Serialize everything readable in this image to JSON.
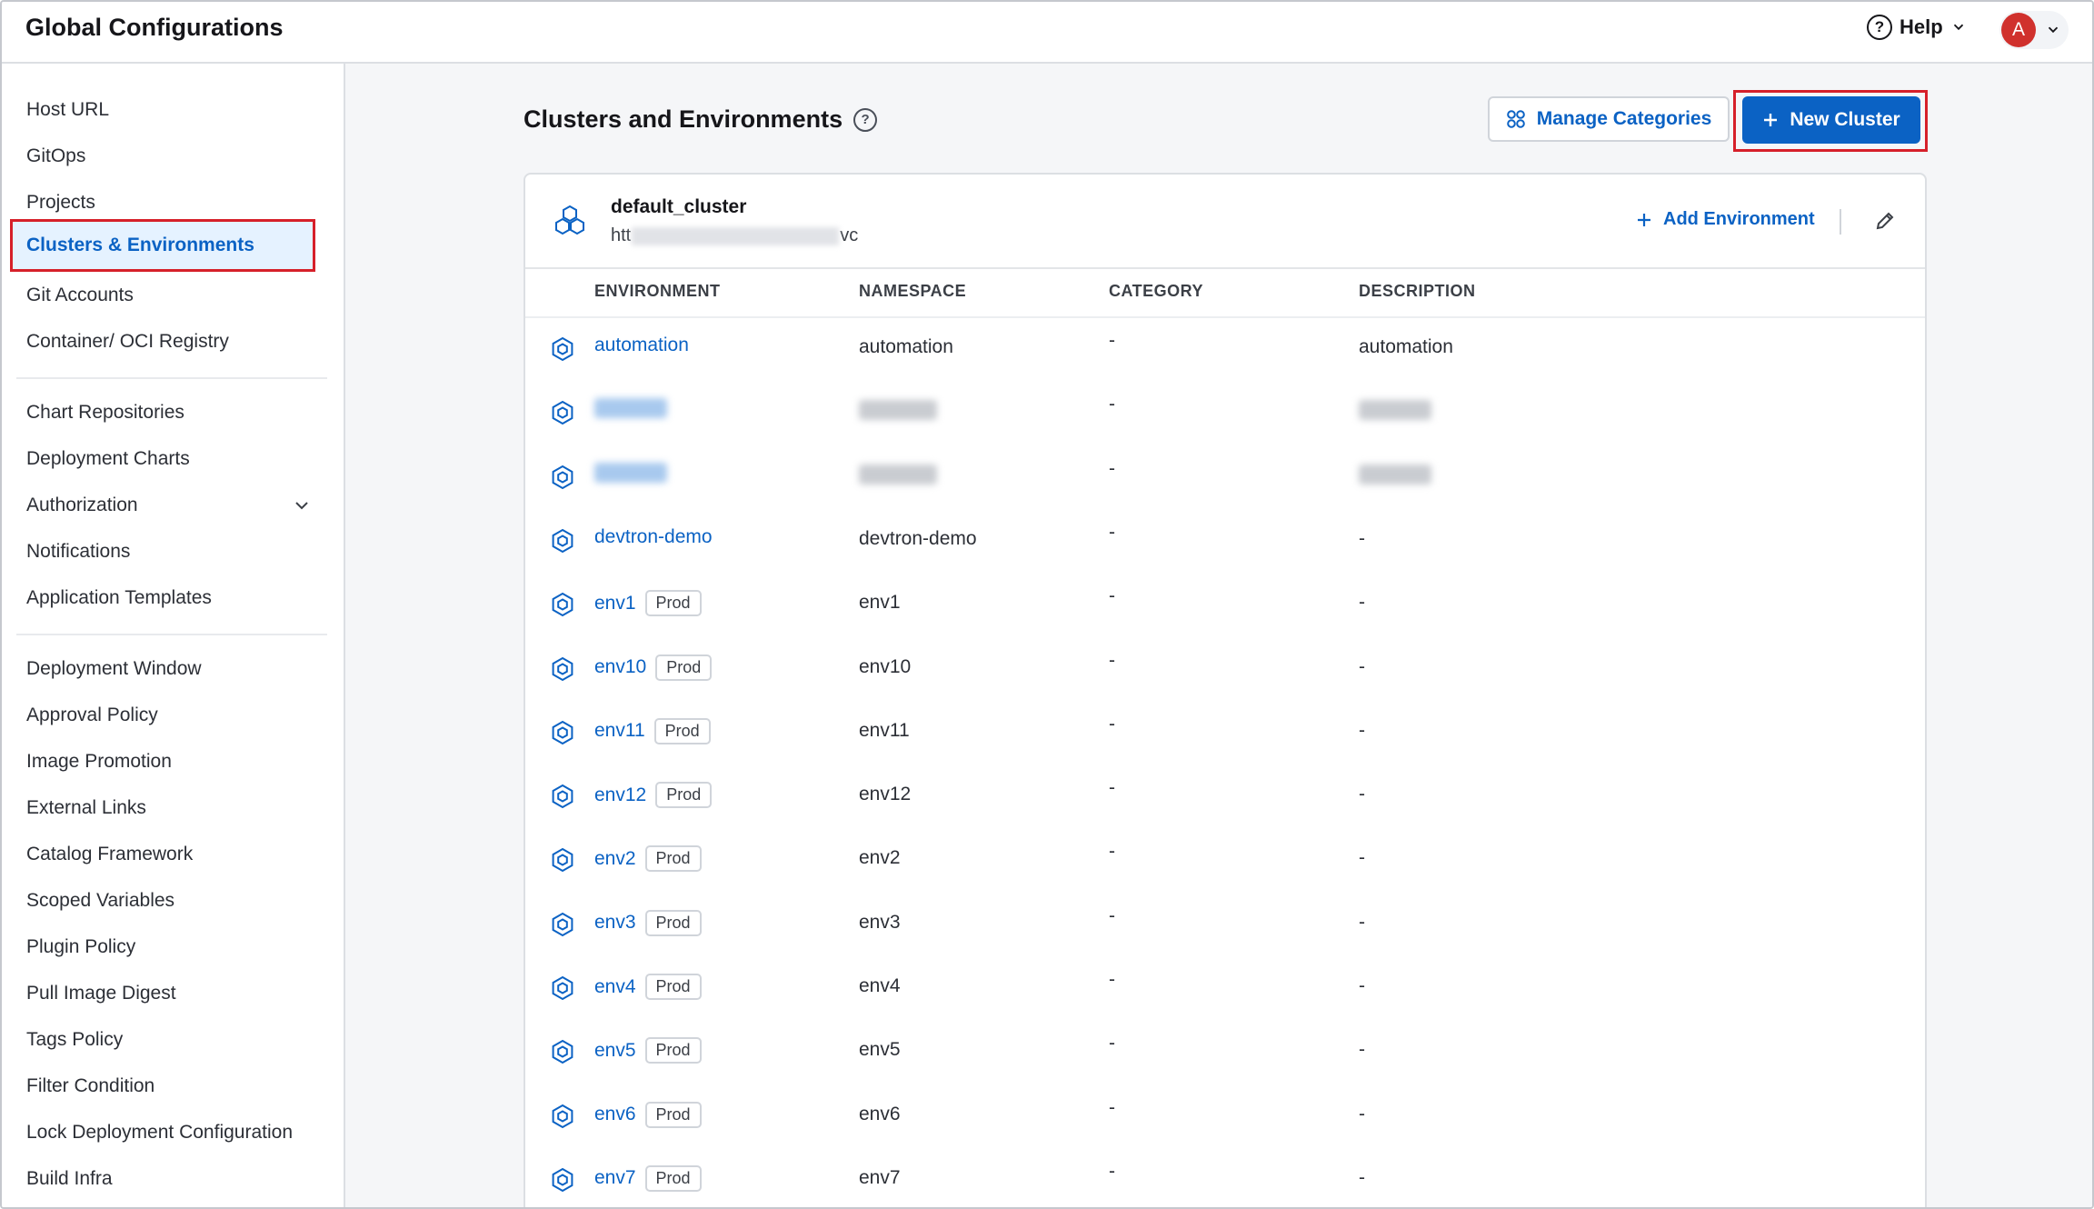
{
  "app": {
    "title": "Global Configurations"
  },
  "header": {
    "help_label": "Help",
    "avatar_initial": "A"
  },
  "sidebar": {
    "items": [
      "Host URL",
      "GitOps",
      "Projects",
      "Clusters & Environments",
      "Git Accounts",
      "Container/ OCI Registry",
      "Chart Repositories",
      "Deployment Charts",
      "Authorization",
      "Notifications",
      "Application Templates",
      "Deployment Window",
      "Approval Policy",
      "Image Promotion",
      "External Links",
      "Catalog Framework",
      "Scoped Variables",
      "Plugin Policy",
      "Pull Image Digest",
      "Tags Policy",
      "Filter Condition",
      "Lock Deployment Configuration",
      "Build Infra"
    ],
    "active": "Clusters & Environments"
  },
  "main": {
    "title": "Clusters and Environments",
    "manage_categories_label": "Manage Categories",
    "new_cluster_label": "New Cluster"
  },
  "cluster": {
    "name": "default_cluster",
    "url_prefix": "htt",
    "url_suffix": "vc",
    "add_environment_label": "Add Environment",
    "columns": [
      "ENVIRONMENT",
      "NAMESPACE",
      "CATEGORY",
      "DESCRIPTION"
    ],
    "rows": [
      {
        "env": "automation",
        "tag": "",
        "namespace": "automation",
        "category": "-",
        "description": "automation",
        "blurred": false
      },
      {
        "env": "",
        "tag": "",
        "namespace": "",
        "category": "-",
        "description": "",
        "blurred": true
      },
      {
        "env": "",
        "tag": "",
        "namespace": "",
        "category": "-",
        "description": "",
        "blurred": true
      },
      {
        "env": "devtron-demo",
        "tag": "",
        "namespace": "devtron-demo",
        "category": "-",
        "description": "-",
        "blurred": false
      },
      {
        "env": "env1",
        "tag": "Prod",
        "namespace": "env1",
        "category": "-",
        "description": "-",
        "blurred": false
      },
      {
        "env": "env10",
        "tag": "Prod",
        "namespace": "env10",
        "category": "-",
        "description": "-",
        "blurred": false
      },
      {
        "env": "env11",
        "tag": "Prod",
        "namespace": "env11",
        "category": "-",
        "description": "-",
        "blurred": false
      },
      {
        "env": "env12",
        "tag": "Prod",
        "namespace": "env12",
        "category": "-",
        "description": "-",
        "blurred": false
      },
      {
        "env": "env2",
        "tag": "Prod",
        "namespace": "env2",
        "category": "-",
        "description": "-",
        "blurred": false
      },
      {
        "env": "env3",
        "tag": "Prod",
        "namespace": "env3",
        "category": "-",
        "description": "-",
        "blurred": false
      },
      {
        "env": "env4",
        "tag": "Prod",
        "namespace": "env4",
        "category": "-",
        "description": "-",
        "blurred": false
      },
      {
        "env": "env5",
        "tag": "Prod",
        "namespace": "env5",
        "category": "-",
        "description": "-",
        "blurred": false
      },
      {
        "env": "env6",
        "tag": "Prod",
        "namespace": "env6",
        "category": "-",
        "description": "-",
        "blurred": false
      },
      {
        "env": "env7",
        "tag": "Prod",
        "namespace": "env7",
        "category": "-",
        "description": "-",
        "blurred": false
      }
    ]
  },
  "colors": {
    "accent": "#0b62c4",
    "highlight": "#d6202a",
    "active_bg": "#e5f2ff"
  }
}
